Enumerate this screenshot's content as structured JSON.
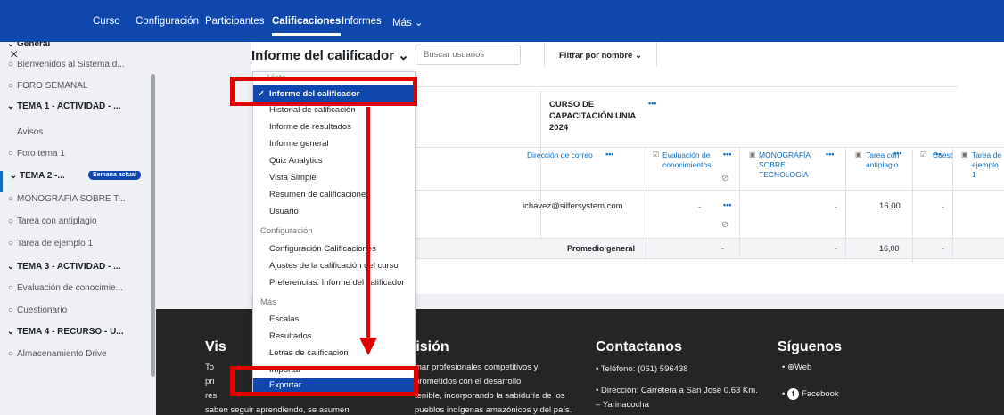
{
  "topnav": {
    "items": [
      "Curso",
      "Configuración",
      "Participantes",
      "Calificaciones",
      "Informes",
      "Más ⌄"
    ],
    "active": "Calificaciones"
  },
  "sidebar": {
    "close": "×",
    "items": [
      {
        "text": "General",
        "type": "section",
        "icon": "⌄"
      },
      {
        "text": "Bienvenidos al Sistema d...",
        "icon": "○"
      },
      {
        "text": "FORO SEMANAL",
        "icon": "○"
      },
      {
        "text": "TEMA 1 - ACTIVIDAD - ...",
        "type": "section",
        "icon": "⌄"
      },
      {
        "text": "Avisos",
        "icon": ""
      },
      {
        "text": "Foro tema 1",
        "icon": "○"
      },
      {
        "text": "TEMA 2 -...",
        "type": "section",
        "icon": "⌄",
        "badge": "Semana actual"
      },
      {
        "text": "MONOGRAFÍA SOBRE T...",
        "icon": "○"
      },
      {
        "text": "Tarea con antiplagio",
        "icon": "○"
      },
      {
        "text": "Tarea de ejemplo 1",
        "icon": "○"
      },
      {
        "text": "TEMA 3 - ACTIVIDAD - ...",
        "type": "section",
        "icon": "⌄"
      },
      {
        "text": "Evaluación de conocimie...",
        "icon": "○"
      },
      {
        "text": "Cuestionario",
        "icon": "○"
      },
      {
        "text": "TEMA 4 - RECURSO - U...",
        "type": "section",
        "icon": "⌄"
      },
      {
        "text": "Almacenamiento Drive",
        "icon": "○"
      }
    ]
  },
  "report": {
    "title": "Informe del calificador ⌄",
    "search_placeholder": "Buscar usuarios",
    "filter": "Filtrar por nombre ⌄",
    "course_title": "CURSO DE CAPACITACIÓN UNIA 2024",
    "dots": "•••",
    "headers": {
      "email": "Dirección de correo",
      "eval": "Evaluación de conocimientos",
      "mono": "MONOGRAFÍA SOBRE TECNOLOGÍA",
      "tarea": "Tarea con antiplagio",
      "ejemplo": "Tarea de ejemplo 1",
      "cuest": "Cuest"
    },
    "row": {
      "email": "ichavez@silfersystem.com",
      "eval": "-",
      "mono": "-",
      "tarea": "-",
      "ejemplo": "16,00"
    },
    "avg": {
      "label": "Promedio general",
      "eval": "-",
      "mono": "-",
      "tarea": "-",
      "ejemplo": "16,00"
    }
  },
  "dropdown": {
    "group_vista": "Vista",
    "vista_items": [
      "Informe del calificador",
      "Historial de calificación",
      "Informe de resultados",
      "Informe general",
      "Quiz Analytics",
      "Vista Simple",
      "Resumen de calificaciones",
      "Usuario"
    ],
    "group_config": "Configuración",
    "config_items": [
      "Configuración Calificaciones",
      "Ajustes de la calificación del curso",
      "Preferencias: Informe del calificador"
    ],
    "group_mas": "Más",
    "mas_items": [
      "Escalas",
      "Resultados",
      "Letras de calificación",
      "Importar",
      "Exportar"
    ],
    "check": "✓"
  },
  "footer": {
    "vision_title": "Vis",
    "vision_lines": [
      "To",
      "pri",
      "res",
      "saben seguir aprendiendo, se asumen"
    ],
    "mision_title": "Misión",
    "mision_lines": [
      "mar profesionales competitivos y",
      "prometidos con el desarrollo",
      "tenible, incorporando la sabiduría de los",
      "pueblos indígenas amazónicos y del país."
    ],
    "contact_title": "Contactanos",
    "contact_phone": "Teléfono: (061) 596438",
    "contact_addr1": "Dirección: Carretera a San José 0.63 Km.",
    "contact_addr2": "– Yarinacocha",
    "follow_title": "Síguenos",
    "web": "Web",
    "facebook": "Facebook"
  },
  "colors": {
    "brand": "#0f47ad",
    "highlight": "#e00000",
    "footer": "#252525"
  }
}
